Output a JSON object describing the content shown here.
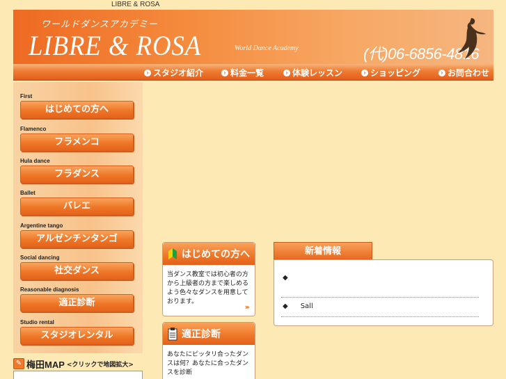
{
  "window_title": "LIBRE & ROSA",
  "header": {
    "kana": "ワールドダンスアカデミー",
    "brand": "LIBRE & ROSA",
    "subtitle": "World Dance Academy",
    "phone": "(代)06-6856-4816"
  },
  "nav": [
    {
      "label": "スタジオ紹介"
    },
    {
      "label": "料金一覧"
    },
    {
      "label": "体験レッスン"
    },
    {
      "label": "ショッピング"
    },
    {
      "label": "お問合わせ"
    }
  ],
  "sidebar": [
    {
      "category": "First",
      "label": "はじめての方へ"
    },
    {
      "category": "Flamenco",
      "label": "フラメンコ"
    },
    {
      "category": "Hula dance",
      "label": "フラダンス"
    },
    {
      "category": "Ballet",
      "label": "バレエ"
    },
    {
      "category": "Argentine tango",
      "label": "アルゼンチンタンゴ"
    },
    {
      "category": "Social dancing",
      "label": "社交ダンス"
    },
    {
      "category": "Reasonable diagnosis",
      "label": "適正診断"
    },
    {
      "category": "Studio rental",
      "label": "スタジオレンタル"
    }
  ],
  "map": {
    "title": "梅田MAP",
    "note": "<クリックで地図拡大>"
  },
  "cards": [
    {
      "title": "はじめての方へ",
      "text": "当ダンス教室では初心者の方から上級者の方まで楽しめるよう色々なダンスを用意しております。",
      "more": "›››"
    },
    {
      "title": "適正診断",
      "text": "あなたにピッタリ合ったダンスは何？あなたに合ったダンスを診断",
      "more": ""
    }
  ],
  "news": {
    "tab_label": "新着情報",
    "items": [
      {
        "bullet": "◆",
        "text": ""
      },
      {
        "bullet": "◆",
        "text": "Sall"
      }
    ]
  },
  "colors": {
    "accent": "#ee7626",
    "background": "#fde9b4"
  }
}
